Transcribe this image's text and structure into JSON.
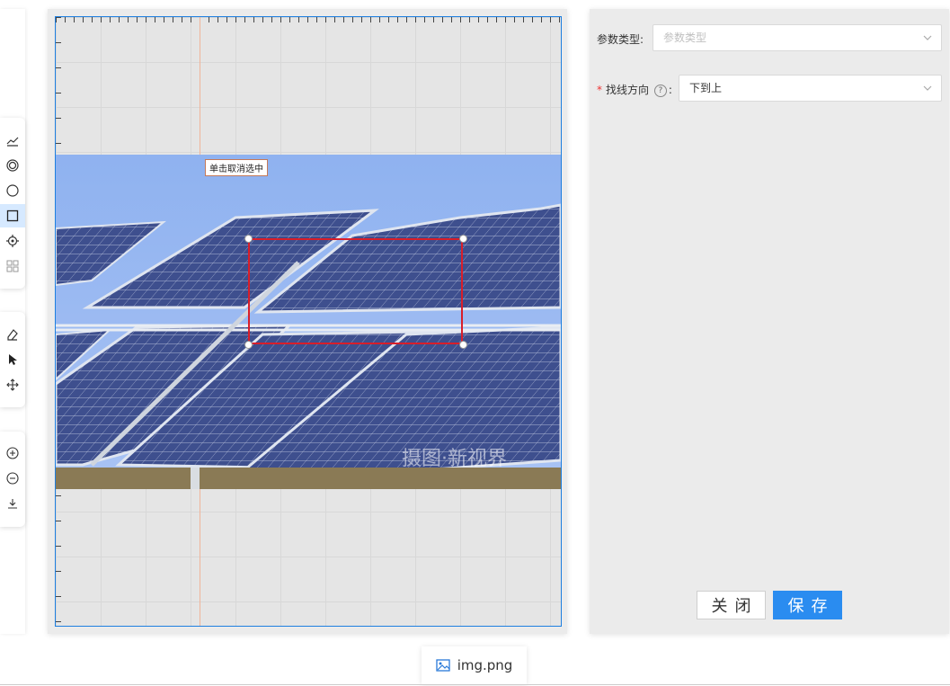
{
  "toolbar": {
    "groups": [
      {
        "tools": [
          {
            "name": "polyline-tool",
            "icon": "polyline-icon",
            "active": false
          },
          {
            "name": "ring-tool",
            "icon": "concentric-circle-icon",
            "active": false
          },
          {
            "name": "circle-tool",
            "icon": "circle-icon",
            "active": false
          },
          {
            "name": "rectangle-tool",
            "icon": "rectangle-icon",
            "active": true
          },
          {
            "name": "point-tool",
            "icon": "crosshair-icon",
            "active": false
          },
          {
            "name": "grid-tool",
            "icon": "grid-icon",
            "active": false
          }
        ]
      },
      {
        "tools": [
          {
            "name": "eraser-tool",
            "icon": "eraser-icon",
            "active": false
          },
          {
            "name": "select-tool",
            "icon": "cursor-icon",
            "active": false
          },
          {
            "name": "move-tool",
            "icon": "move-icon",
            "active": false
          }
        ]
      },
      {
        "tools": [
          {
            "name": "zoom-in-tool",
            "icon": "zoom-in-icon",
            "active": false
          },
          {
            "name": "zoom-out-tool",
            "icon": "zoom-out-icon",
            "active": false
          },
          {
            "name": "download-tool",
            "icon": "download-icon",
            "active": false
          }
        ]
      }
    ]
  },
  "canvas": {
    "tooltip": "单击取消选中",
    "watermark": "摄图·新视界",
    "image_subject": "solar panels"
  },
  "form": {
    "param_type": {
      "label": "参数类型:",
      "placeholder": "参数类型",
      "value": ""
    },
    "search_direction": {
      "label": "找线方向",
      "colon": ":",
      "required_mark": "*",
      "help_icon": "?",
      "value": "下到上"
    }
  },
  "actions": {
    "close_label": "关闭",
    "save_label": "保存"
  },
  "file_tab": {
    "name": "img.png",
    "icon": "image-icon"
  },
  "colors": {
    "accent": "#2a8cf0",
    "selection": "#d81e2a",
    "canvas_border": "#1e7fe0"
  }
}
